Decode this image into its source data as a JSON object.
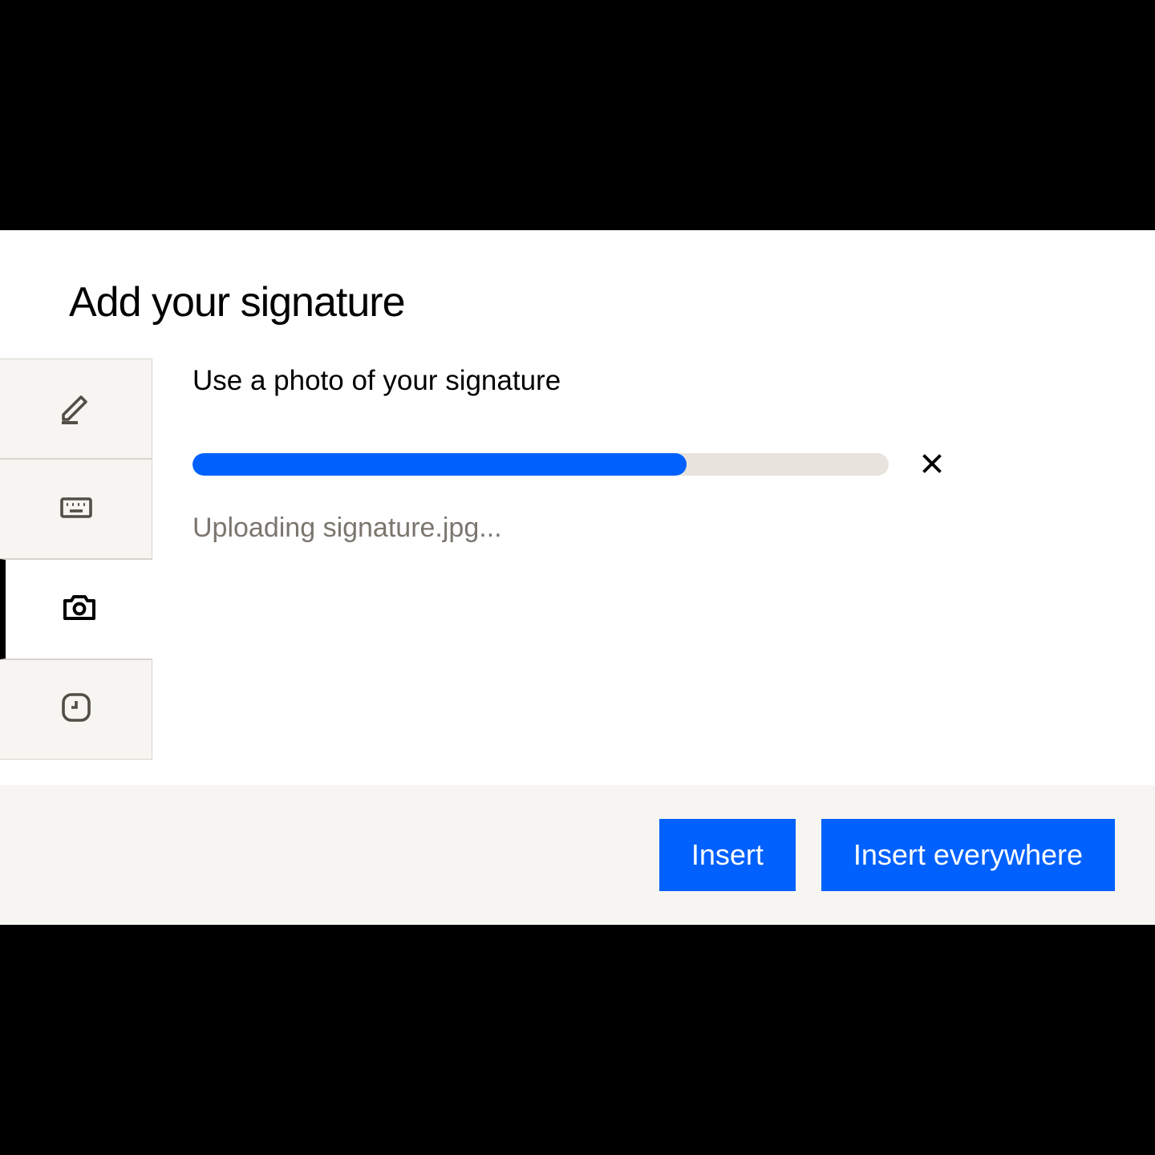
{
  "dialog": {
    "title": "Add your signature",
    "subtitle": "Use a photo of your signature",
    "upload_status": "Uploading signature.jpg...",
    "progress_percent": 71
  },
  "tabs": {
    "draw": "draw-tab",
    "type": "type-tab",
    "photo": "photo-tab",
    "recent": "recent-tab"
  },
  "footer": {
    "insert_label": "Insert",
    "insert_everywhere_label": "Insert everywhere"
  },
  "colors": {
    "primary": "#0061fe",
    "bg_muted": "#f7f5f2",
    "border": "#d8d3cb",
    "text_muted": "#7a766e"
  }
}
